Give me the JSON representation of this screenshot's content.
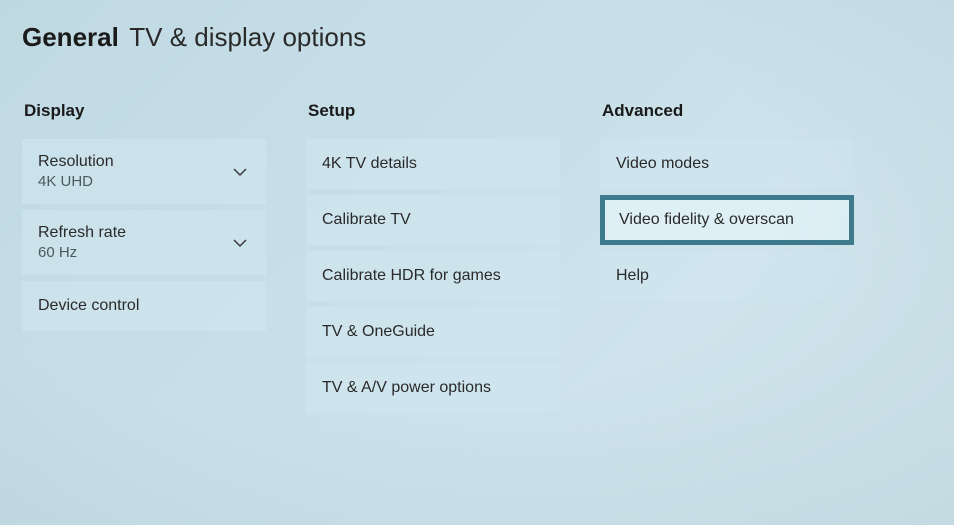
{
  "header": {
    "general": "General",
    "subtitle": "TV & display options"
  },
  "columns": {
    "display": {
      "title": "Display",
      "items": [
        {
          "label": "Resolution",
          "sub": "4K UHD",
          "dropdown": true
        },
        {
          "label": "Refresh rate",
          "sub": "60 Hz",
          "dropdown": true
        },
        {
          "label": "Device control"
        }
      ]
    },
    "setup": {
      "title": "Setup",
      "items": [
        {
          "label": "4K TV details"
        },
        {
          "label": "Calibrate TV"
        },
        {
          "label": "Calibrate HDR for games"
        },
        {
          "label": "TV & OneGuide"
        },
        {
          "label": "TV & A/V power options"
        }
      ]
    },
    "advanced": {
      "title": "Advanced",
      "items": [
        {
          "label": "Video modes"
        },
        {
          "label": "Video fidelity & overscan",
          "focused": true
        },
        {
          "label": "Help"
        }
      ]
    }
  }
}
